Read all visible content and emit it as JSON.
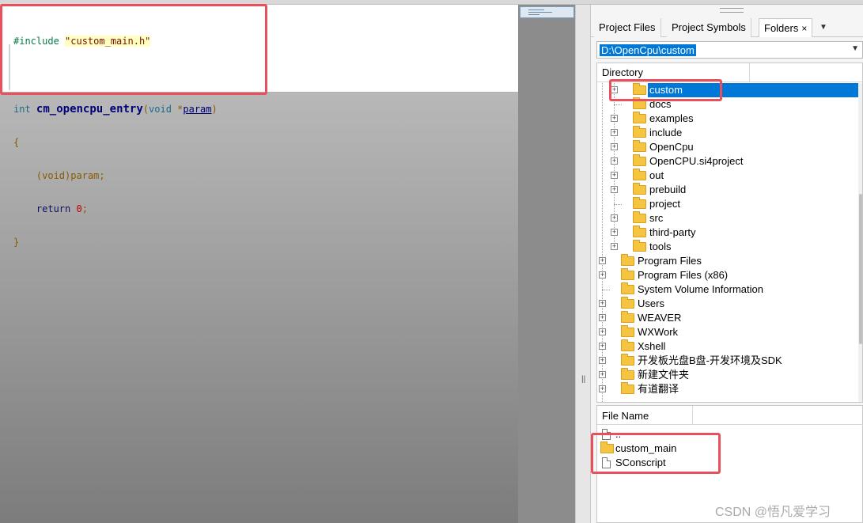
{
  "editor": {
    "lines": {
      "include_kw": "#include",
      "include_file": "\"custom_main.h\"",
      "ret_type": "int",
      "fn_name": "cm_opencpu_entry",
      "open_paren": "(",
      "void_kw": "void",
      "star": " *",
      "param": "param",
      "close_paren": ")",
      "open_brace": "{",
      "cast": "(void)",
      "cast_param": "param;",
      "return_kw": "return",
      "zero": "0",
      "semicolon": ";",
      "close_brace": "}"
    }
  },
  "panel": {
    "tabs": [
      {
        "label": "Project Files"
      },
      {
        "label": "Project Symbols"
      },
      {
        "label": "Folders"
      }
    ],
    "tab_close": "×",
    "tab_more": "▼",
    "path": "D:\\OpenCpu\\custom",
    "path_arrow": "▼",
    "directory_header": "Directory",
    "tree": [
      {
        "label": "custom"
      },
      {
        "label": "docs"
      },
      {
        "label": "examples"
      },
      {
        "label": "include"
      },
      {
        "label": "OpenCpu"
      },
      {
        "label": "OpenCPU.si4project"
      },
      {
        "label": "out"
      },
      {
        "label": "prebuild"
      },
      {
        "label": "project"
      },
      {
        "label": "src"
      },
      {
        "label": "third-party"
      },
      {
        "label": "tools"
      },
      {
        "label": "Program Files"
      },
      {
        "label": "Program Files (x86)"
      },
      {
        "label": "System Volume Information"
      },
      {
        "label": "Users"
      },
      {
        "label": "WEAVER"
      },
      {
        "label": "WXWork"
      },
      {
        "label": "Xshell"
      },
      {
        "label": "开发板光盘B盘-开发环境及SDK"
      },
      {
        "label": "新建文件夹"
      },
      {
        "label": "有道翻译"
      }
    ],
    "file_header": "File Name",
    "files": [
      {
        "label": ".."
      },
      {
        "label": "custom_main"
      },
      {
        "label": "SConscript"
      }
    ]
  },
  "watermark": "CSDN @悟凡爱学习",
  "colors": {
    "selection": "#0078d7",
    "annotation": "#e8505b",
    "folder": "#f5c542"
  }
}
